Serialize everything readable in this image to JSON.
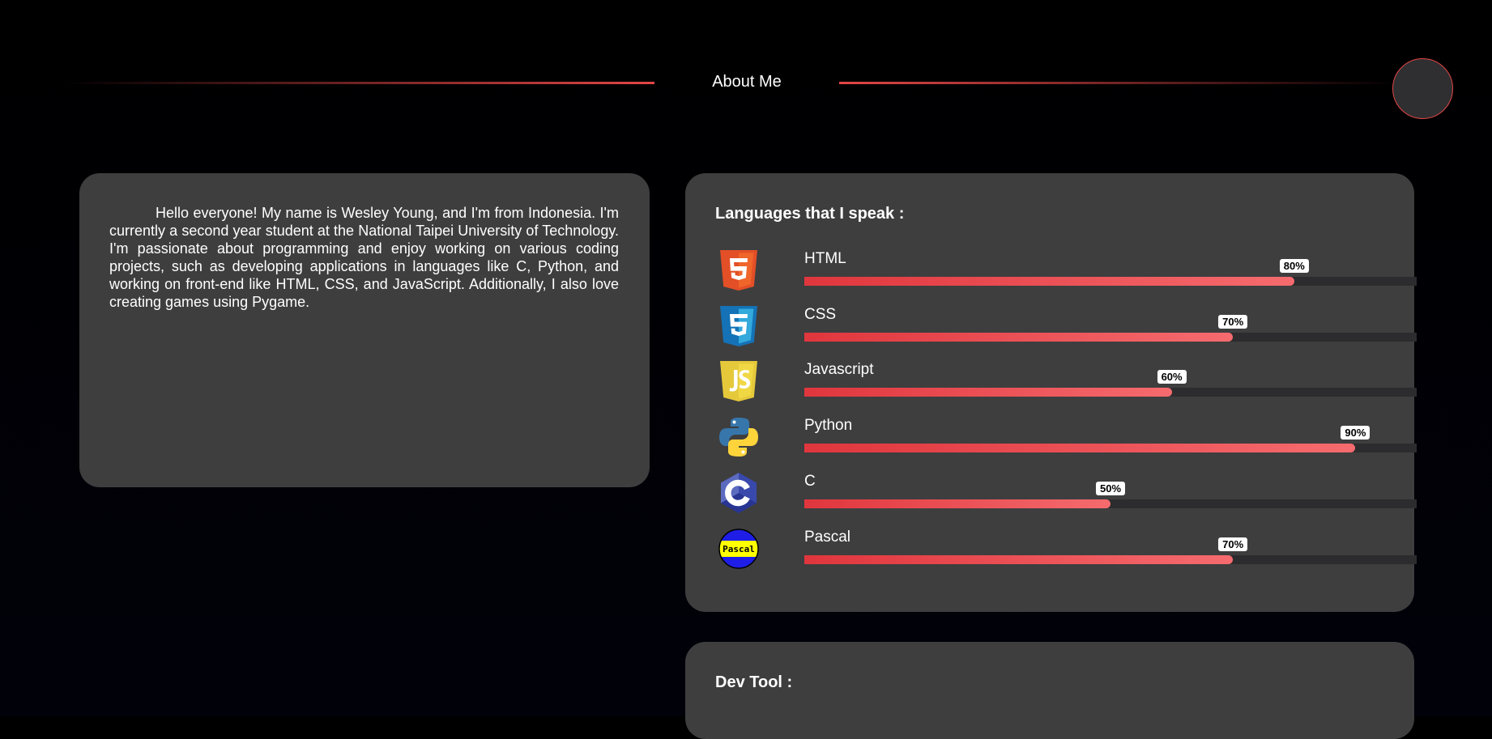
{
  "header": {
    "title": "About Me"
  },
  "about": {
    "text": "Hello everyone! My name is Wesley Young, and I'm from Indonesia. I'm currently a second year student at the National Taipei University of Technology. I'm passionate about programming and enjoy working on various coding projects, such as developing applications in languages like C, Python, and working on front-end like HTML, CSS, and JavaScript. Additionally, I also love creating games using Pygame."
  },
  "languages": {
    "title": "Languages that I speak :",
    "items": [
      {
        "name": "HTML",
        "percent": 80,
        "percent_label": "80%",
        "icon": "html5-icon"
      },
      {
        "name": "CSS",
        "percent": 70,
        "percent_label": "70%",
        "icon": "css3-icon"
      },
      {
        "name": "Javascript",
        "percent": 60,
        "percent_label": "60%",
        "icon": "javascript-icon"
      },
      {
        "name": "Python",
        "percent": 90,
        "percent_label": "90%",
        "icon": "python-icon"
      },
      {
        "name": "C",
        "percent": 50,
        "percent_label": "50%",
        "icon": "c-language-icon"
      },
      {
        "name": "Pascal",
        "percent": 70,
        "percent_label": "70%",
        "icon": "pascal-icon",
        "icon_text": "Pascal"
      }
    ]
  },
  "dev_tool": {
    "title": "Dev Tool :"
  },
  "colors": {
    "accent": "#e44646",
    "card": "#3e3e3f",
    "bar_track": "#2c2c2e"
  }
}
